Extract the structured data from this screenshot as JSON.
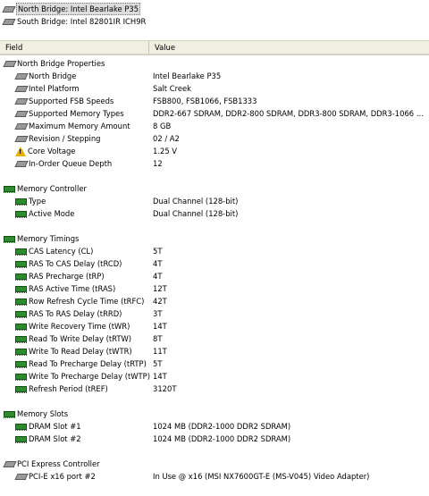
{
  "device_list": [
    {
      "icon": "north-bridge-icon",
      "label": "North Bridge: Intel Bearlake P35",
      "selected": true
    },
    {
      "icon": "south-bridge-icon",
      "label": "South Bridge: Intel 82801IR ICH9R",
      "selected": false
    }
  ],
  "columns": {
    "field": "Field",
    "value": "Value"
  },
  "rows": [
    {
      "type": "section",
      "icon": "north-bridge-icon",
      "field": "North Bridge Properties",
      "value": ""
    },
    {
      "type": "item",
      "icon": "north-bridge-icon",
      "field": "North Bridge",
      "value": "Intel Bearlake P35"
    },
    {
      "type": "item",
      "icon": "north-bridge-icon",
      "field": "Intel Platform",
      "value": "Salt Creek"
    },
    {
      "type": "item",
      "icon": "north-bridge-icon",
      "field": "Supported FSB Speeds",
      "value": "FSB800, FSB1066, FSB1333"
    },
    {
      "type": "item",
      "icon": "north-bridge-icon",
      "field": "Supported Memory Types",
      "value": "DDR2-667 SDRAM, DDR2-800 SDRAM, DDR3-800 SDRAM, DDR3-1066 SDR..."
    },
    {
      "type": "item",
      "icon": "north-bridge-icon",
      "field": "Maximum Memory Amount",
      "value": "8 GB"
    },
    {
      "type": "item",
      "icon": "north-bridge-icon",
      "field": "Revision / Stepping",
      "value": "02 / A2"
    },
    {
      "type": "item",
      "icon": "warning-icon",
      "field": "Core Voltage",
      "value": "1.25 V"
    },
    {
      "type": "item",
      "icon": "north-bridge-icon",
      "field": "In-Order Queue Depth",
      "value": "12"
    },
    {
      "type": "blank"
    },
    {
      "type": "section",
      "icon": "memory-icon",
      "field": "Memory Controller",
      "value": ""
    },
    {
      "type": "item",
      "icon": "memory-icon",
      "field": "Type",
      "value": "Dual Channel  (128-bit)"
    },
    {
      "type": "item",
      "icon": "memory-icon",
      "field": "Active Mode",
      "value": "Dual Channel  (128-bit)"
    },
    {
      "type": "blank"
    },
    {
      "type": "section",
      "icon": "memory-icon",
      "field": "Memory Timings",
      "value": ""
    },
    {
      "type": "item",
      "icon": "memory-icon",
      "field": "CAS Latency (CL)",
      "value": "5T"
    },
    {
      "type": "item",
      "icon": "memory-icon",
      "field": "RAS To CAS Delay (tRCD)",
      "value": "4T"
    },
    {
      "type": "item",
      "icon": "memory-icon",
      "field": "RAS Precharge (tRP)",
      "value": "4T"
    },
    {
      "type": "item",
      "icon": "memory-icon",
      "field": "RAS Active Time (tRAS)",
      "value": "12T"
    },
    {
      "type": "item",
      "icon": "memory-icon",
      "field": "Row Refresh Cycle Time (tRFC)",
      "value": "42T"
    },
    {
      "type": "item",
      "icon": "memory-icon",
      "field": "RAS To RAS Delay (tRRD)",
      "value": "3T"
    },
    {
      "type": "item",
      "icon": "memory-icon",
      "field": "Write Recovery Time (tWR)",
      "value": "14T"
    },
    {
      "type": "item",
      "icon": "memory-icon",
      "field": "Read To Write Delay (tRTW)",
      "value": "8T"
    },
    {
      "type": "item",
      "icon": "memory-icon",
      "field": "Write To Read Delay (tWTR)",
      "value": "11T"
    },
    {
      "type": "item",
      "icon": "memory-icon",
      "field": "Read To Precharge Delay (tRTP)",
      "value": "5T"
    },
    {
      "type": "item",
      "icon": "memory-icon",
      "field": "Write To Precharge Delay (tWTP)",
      "value": "14T"
    },
    {
      "type": "item",
      "icon": "memory-icon",
      "field": "Refresh Period (tREF)",
      "value": "3120T"
    },
    {
      "type": "blank"
    },
    {
      "type": "section",
      "icon": "memory-icon",
      "field": "Memory Slots",
      "value": ""
    },
    {
      "type": "item",
      "icon": "memory-icon",
      "field": "DRAM Slot #1",
      "value": "1024 MB  (DDR2-1000 DDR2 SDRAM)"
    },
    {
      "type": "item",
      "icon": "memory-icon",
      "field": "DRAM Slot #2",
      "value": "1024 MB  (DDR2-1000 DDR2 SDRAM)"
    },
    {
      "type": "blank"
    },
    {
      "type": "section",
      "icon": "north-bridge-icon",
      "field": "PCI Express Controller",
      "value": ""
    },
    {
      "type": "item",
      "icon": "north-bridge-icon",
      "field": "PCI-E x16 port #2",
      "value": "In Use @ x16  (MSI NX7600GT-E (MS-V045) Video Adapter)"
    }
  ]
}
